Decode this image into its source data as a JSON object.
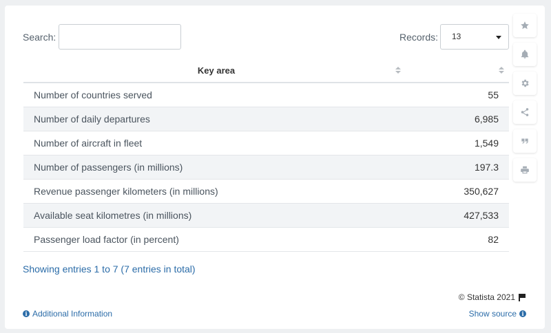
{
  "search": {
    "label": "Search:",
    "value": ""
  },
  "records": {
    "label": "Records:",
    "selected": "13"
  },
  "table": {
    "headers": [
      "Key area",
      ""
    ],
    "rows": [
      {
        "key": "Number of countries served",
        "value": "55"
      },
      {
        "key": "Number of daily departures",
        "value": "6,985"
      },
      {
        "key": "Number of aircraft in fleet",
        "value": "1,549"
      },
      {
        "key": "Number of passengers (in millions)",
        "value": "197.3"
      },
      {
        "key": "Revenue passenger kilometers (in millions)",
        "value": "350,627"
      },
      {
        "key": "Available seat kilometres (in millions)",
        "value": "427,533"
      },
      {
        "key": "Passenger load factor (in percent)",
        "value": "82"
      }
    ]
  },
  "footer": {
    "entries": "Showing entries 1 to 7 (7 entries in total)",
    "copyright": "© Statista 2021",
    "additional_info": "Additional Information",
    "show_source": "Show source"
  },
  "sidebar": {
    "icons": [
      "star-icon",
      "bell-icon",
      "gear-icon",
      "share-icon",
      "quote-icon",
      "print-icon"
    ]
  },
  "colors": {
    "link": "#2b6ca8",
    "stripe": "#f2f4f6",
    "background": "#eef0f2"
  }
}
